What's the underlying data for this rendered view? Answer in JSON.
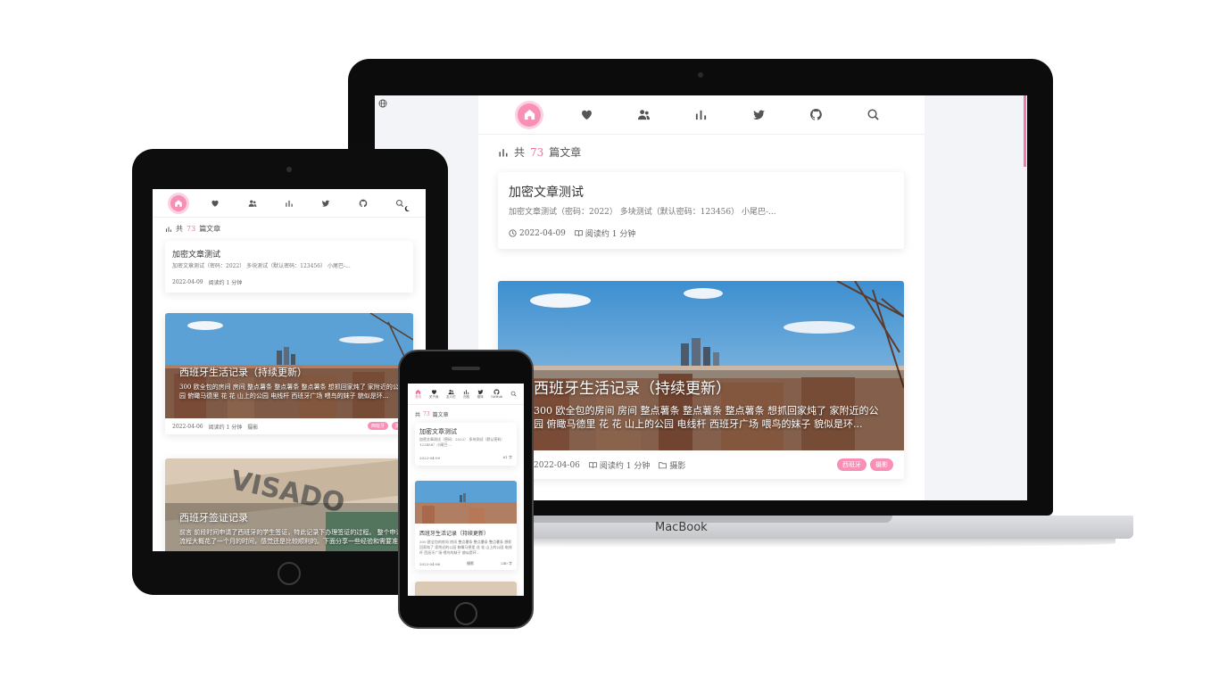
{
  "nav": {
    "items": [
      {
        "icon": "home-icon",
        "active": true
      },
      {
        "icon": "heart-icon"
      },
      {
        "icon": "users-icon"
      },
      {
        "icon": "bar-chart-icon"
      },
      {
        "icon": "twitter-icon"
      },
      {
        "icon": "github-icon"
      },
      {
        "icon": "search-icon"
      }
    ],
    "phone_labels": [
      "首页",
      "关于我",
      "友人们",
      "归档",
      "推特",
      "GitHub"
    ]
  },
  "summary": {
    "prefix": "共",
    "count": "73",
    "suffix": "篇文章"
  },
  "posts": [
    {
      "title": "加密文章测试",
      "excerpt": "加密文章测试（密码：2022） 多块测试（默认密码：123456） 小尾巴-...",
      "excerpt_tablet": "加密文章测试（密码：2022） 多块测试（默认密码：123456） 小尾巴-...",
      "excerpt_phone": "加密文章测试（密码：2022） 多块测试（默认密码：123456）小尾巴-...",
      "date": "2022-04-09",
      "read_time": "阅读约 1 分钟",
      "phone_stat": "61 字"
    },
    {
      "title": "西班牙生活记录（持续更新）",
      "excerpt": "300 欧全包的房间 房间 整点薯条 整点薯条 整点薯条 想抓回家炖了 家附近的公园 俯瞰马德里 花 花 山上的公园 电线杆 西班牙广场 喂鸟的妹子 貌似是环...",
      "excerpt_phone": "300 欧全包的房间 房间 整点薯条 整点薯条 整点薯条 想抓回家炖了 家附近的公园 俯瞰马德里 花 花 山上的公园 电线杆 西班牙广场 喂鸟的妹子 貌似是环...",
      "date": "2022-04-06",
      "read_time": "阅读约 1 分钟",
      "category": "摄影",
      "tags": [
        "西班牙",
        "摄影"
      ],
      "phone_stat": "240 字"
    },
    {
      "title": "西班牙签证记录",
      "excerpt": "前言 前段时间申请了西班牙的学生签证，特此记录下办理签证的过程。 整个申请流程大概花了一个月的时间，感觉还是比较顺利的。下面分享一些经验和需要准备的材料..."
    }
  ],
  "device": {
    "laptop_brand": "MacBook"
  },
  "colors": {
    "accent": "#f88fb6",
    "accent_text": "#f06f9c"
  }
}
